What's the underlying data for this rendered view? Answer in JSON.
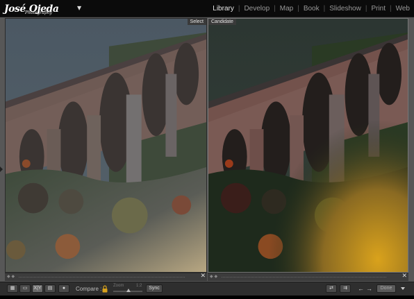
{
  "identity": {
    "name": "José",
    "name2": "Ojeda",
    "sub": "Photography",
    "menu_glyph": "▼"
  },
  "modules": [
    {
      "label": "Library",
      "active": true
    },
    {
      "label": "Develop",
      "active": false
    },
    {
      "label": "Map",
      "active": false
    },
    {
      "label": "Book",
      "active": false
    },
    {
      "label": "Slideshow",
      "active": false
    },
    {
      "label": "Print",
      "active": false
    },
    {
      "label": "Web",
      "active": false
    }
  ],
  "panels": {
    "select": {
      "label": "Select",
      "close": "✕"
    },
    "candidate": {
      "label": "Candidate",
      "close": "✕"
    }
  },
  "toolbar": {
    "compare_label": "Compare :",
    "zoom_label": "Zoom",
    "zoom_value": "1:2",
    "sync_label": "Sync",
    "done_label": "Done",
    "view_xy": "X|Y"
  },
  "colors": {
    "chrome": "#575757",
    "accent_active": "#e8e8e8",
    "sky": "#4a5a66",
    "bridge": "#6d5852",
    "foliage": "#3b4a2e",
    "warm_glow": "#c9951e"
  }
}
